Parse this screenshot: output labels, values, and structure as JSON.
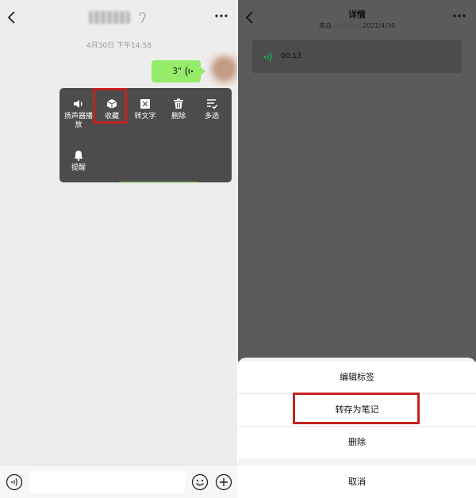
{
  "left_screen": {
    "timestamp": "4月30日 下午14:58",
    "voice_message": {
      "duration": "3\""
    },
    "menu": {
      "items": [
        {
          "label": "扬声器播放",
          "icon": "speaker-icon"
        },
        {
          "label": "收藏",
          "icon": "favorite-cube-icon"
        },
        {
          "label": "转文字",
          "icon": "convert-text-icon"
        },
        {
          "label": "删除",
          "icon": "trash-icon"
        },
        {
          "label": "多选",
          "icon": "multi-select-icon"
        },
        {
          "label": "提醒",
          "icon": "bell-icon"
        }
      ],
      "highlighted": "收藏"
    },
    "input_bar": {
      "value": ""
    }
  },
  "right_screen": {
    "title": "详情",
    "subtitle_prefix": "来自",
    "subtitle_date": "2021/4/30",
    "voice_card": {
      "duration": "00:13"
    },
    "action_sheet": {
      "items": [
        "编辑标签",
        "转存为笔记",
        "删除"
      ],
      "cancel": "取消",
      "highlighted": "转存为笔记"
    }
  },
  "colors": {
    "bubble": "#95ec69",
    "highlight_border": "#c4221f",
    "voice_icon": "#07c160"
  }
}
